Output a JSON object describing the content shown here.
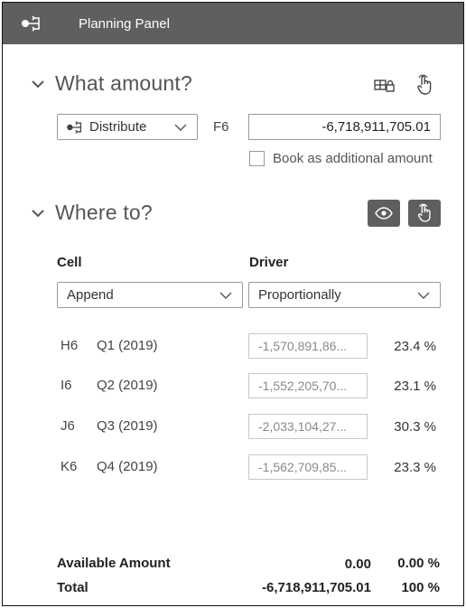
{
  "header": {
    "title": "Planning Panel",
    "icon": "distribute-icon"
  },
  "what_amount": {
    "title": "What amount?",
    "method": {
      "label": "Distribute",
      "icon": "distribute-icon"
    },
    "source_cell": "F6",
    "amount_value": "-6,718,911,705.01",
    "book_additional_label": "Book as additional amount",
    "book_additional_checked": false
  },
  "where_to": {
    "title": "Where to?",
    "cell_header": "Cell",
    "driver_header": "Driver",
    "cell_mode": "Append",
    "driver_mode": "Proportionally",
    "rows": [
      {
        "cell": "H6",
        "period": "Q1 (2019)",
        "value": "-1,570,891,86...",
        "pct": "23.4 %"
      },
      {
        "cell": "I6",
        "period": "Q2 (2019)",
        "value": "-1,552,205,70...",
        "pct": "23.1 %"
      },
      {
        "cell": "J6",
        "period": "Q3 (2019)",
        "value": "-2,033,104,27...",
        "pct": "30.3 %"
      },
      {
        "cell": "K6",
        "period": "Q4 (2019)",
        "value": "-1,562,709,85...",
        "pct": "23.3 %"
      }
    ]
  },
  "footer": {
    "available_label": "Available Amount",
    "available_value": "0.00",
    "available_pct": "0.00 %",
    "total_label": "Total",
    "total_value": "-6,718,911,705.01",
    "total_pct": "100 %"
  },
  "colors": {
    "header_bg": "#5f5f5f",
    "button_bg": "#5f5f5f",
    "border": "#9a9a9a"
  }
}
